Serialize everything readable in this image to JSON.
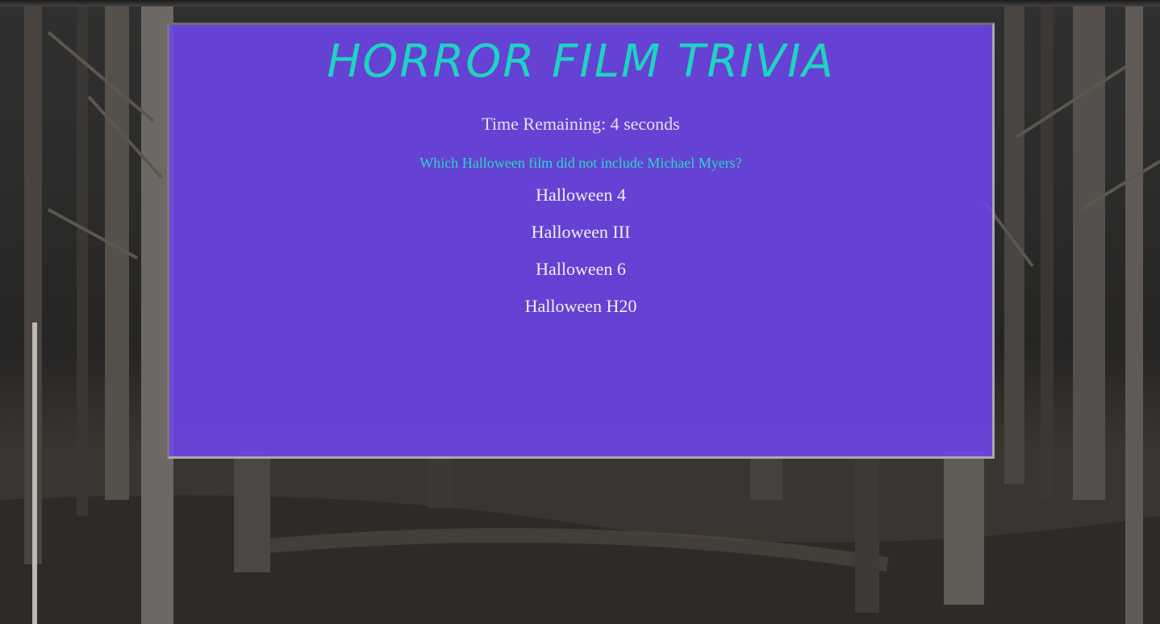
{
  "game": {
    "title": "HORROR FILM TRIVIA",
    "timer_text": "Time Remaining: 4 seconds",
    "question": "Which Halloween film did not include Michael Myers?",
    "answers": [
      "Halloween 4",
      "Halloween III",
      "Halloween 6",
      "Halloween H20"
    ]
  },
  "colors": {
    "panel": "#6f46f0",
    "title": "#1fd3c1",
    "question": "#2ad6c4",
    "text": "#f3eef8"
  }
}
